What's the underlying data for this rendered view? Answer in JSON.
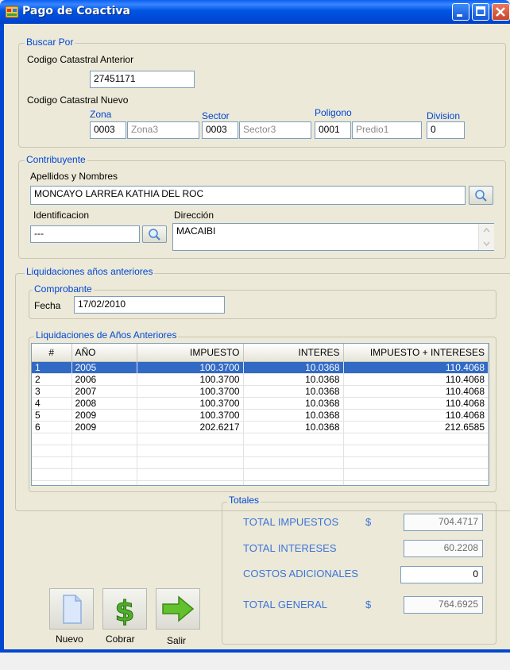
{
  "window": {
    "title": "Pago de Coactiva"
  },
  "buscar": {
    "legend": "Buscar Por",
    "anterior_label": "Codigo Catastral Anterior",
    "anterior_value": "27451171",
    "nuevo_label": "Codigo Catastral Nuevo",
    "zona_label": "Zona",
    "sector_label": "Sector",
    "poligono_label": "Poligono",
    "division_label": "Division",
    "zona_code": "0003",
    "zona_name": "Zona3",
    "sector_code": "0003",
    "sector_name": "Sector3",
    "poligono_code": "0001",
    "poligono_name": "Predio1",
    "division_value": "0"
  },
  "contribuyente": {
    "legend": "Contribuyente",
    "nombres_label": "Apellidos y Nombres",
    "nombres_value": "MONCAYO LARREA KATHIA DEL ROC",
    "ident_label": "Identificacion",
    "ident_value": "---",
    "direccion_label": "Dirección",
    "direccion_value": "MACAIBI"
  },
  "liquidaciones": {
    "legend": "Liquidaciones años anteriores",
    "comprobante_legend": "Comprobante",
    "fecha_label": "Fecha",
    "fecha_value": "17/02/2010",
    "grid_legend": "Liquidaciones de Años Anteriores",
    "columns": [
      "#",
      "AÑO",
      "IMPUESTO",
      "INTERES",
      "IMPUESTO + INTERESES"
    ],
    "rows": [
      [
        "1",
        "2005",
        "100.3700",
        "10.0368",
        "110.4068"
      ],
      [
        "2",
        "2006",
        "100.3700",
        "10.0368",
        "110.4068"
      ],
      [
        "3",
        "2007",
        "100.3700",
        "10.0368",
        "110.4068"
      ],
      [
        "4",
        "2008",
        "100.3700",
        "10.0368",
        "110.4068"
      ],
      [
        "5",
        "2009",
        "100.3700",
        "10.0368",
        "110.4068"
      ],
      [
        "6",
        "2009",
        "202.6217",
        "10.0368",
        "212.6585"
      ]
    ]
  },
  "totales": {
    "legend": "Totales",
    "impuestos_label": "TOTAL IMPUESTOS",
    "impuestos_currency": "$",
    "impuestos_value": "704.4717",
    "intereses_label": "TOTAL INTERESES",
    "intereses_value": "60.2208",
    "costos_label": "COSTOS ADICIONALES",
    "costos_value": "0",
    "general_label": "TOTAL GENERAL",
    "general_currency": "$",
    "general_value": "764.6925"
  },
  "actions": {
    "nuevo": "Nuevo",
    "cobrar": "Cobrar",
    "salir": "Salir"
  },
  "colors": {
    "accent": "#0046d5",
    "selection": "#316ac5",
    "totals_text": "#3b74d9"
  }
}
